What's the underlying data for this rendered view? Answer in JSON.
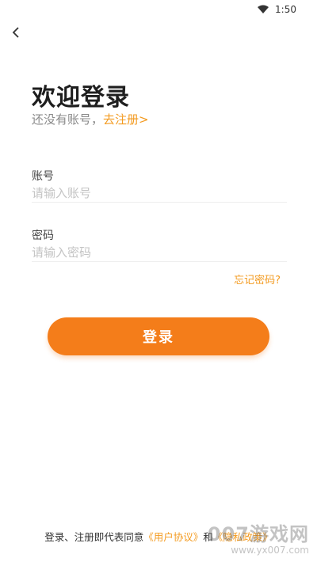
{
  "status_bar": {
    "time": "1:50"
  },
  "header": {
    "title": "欢迎登录"
  },
  "subtitle": {
    "text": "还没有账号，",
    "register_link": "去注册>"
  },
  "account": {
    "label": "账号",
    "placeholder": "请输入账号"
  },
  "password": {
    "label": "密码",
    "placeholder": "请输入密码"
  },
  "forgot_password": "忘记密码?",
  "login_button": "登录",
  "agreement": {
    "prefix": "登录、注册即代表同意",
    "user_agreement": "《用户协议》",
    "and": "和",
    "privacy_policy": "《隐私政策》"
  },
  "watermark": {
    "brand": "007游戏网",
    "url": "www.yx007.com"
  },
  "colors": {
    "accent": "#f39a1f",
    "button": "#f47d1a"
  }
}
